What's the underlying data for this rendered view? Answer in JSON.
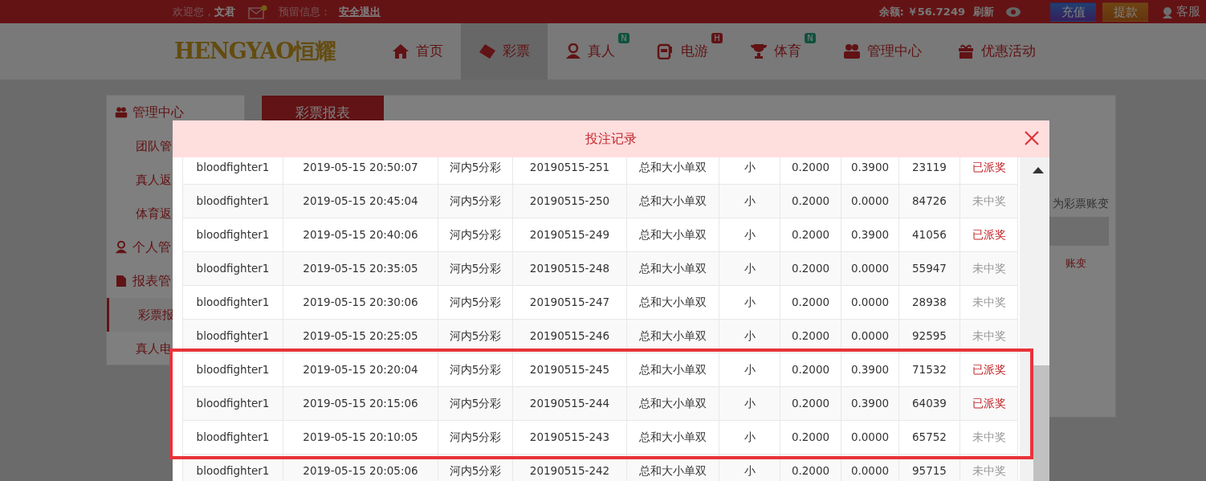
{
  "top_bar": {
    "welcome": "欢迎您，",
    "user": "文君",
    "mail_unread": true,
    "reserved_label": "预留信息：",
    "logout": "安全退出",
    "balance_label": "余额:",
    "balance": "￥56.7249",
    "refresh": "刷新",
    "deposit": "充值",
    "withdraw": "提款",
    "service": "客服"
  },
  "logo": "HENGYAO恒耀",
  "nav": [
    {
      "label": "首页",
      "selected": false
    },
    {
      "label": "彩票",
      "selected": true
    },
    {
      "label": "真人",
      "badge": "N",
      "selected": false
    },
    {
      "label": "电游",
      "badge": "H",
      "selected": false
    },
    {
      "label": "体育",
      "badge": "N",
      "selected": false
    },
    {
      "label": "管理中心",
      "selected": false
    },
    {
      "label": "优惠活动",
      "selected": false
    }
  ],
  "sidebar": {
    "items": [
      {
        "label": "管理中心",
        "kind": "group",
        "selected": false
      },
      {
        "label": "团队管",
        "kind": "item",
        "selected": false
      },
      {
        "label": "真人返",
        "kind": "item",
        "selected": false
      },
      {
        "label": "体育返",
        "kind": "item",
        "selected": false
      },
      {
        "label": "个人管",
        "kind": "group",
        "selected": false
      },
      {
        "label": "报表管",
        "kind": "group",
        "selected": false
      },
      {
        "label": "彩票报",
        "kind": "item",
        "selected": true
      },
      {
        "label": "真人电",
        "kind": "item",
        "selected": false
      }
    ]
  },
  "content": {
    "tab": "彩票报表",
    "note": "为彩票账变",
    "row_text": "账变"
  },
  "modal": {
    "title": "投注记录",
    "rows": [
      {
        "cells": [
          "bloodfighter1",
          "2019-05-15 20:50:07",
          "河内5分彩",
          "20190515-251",
          "总和大小单双",
          "小",
          "0.2000",
          "0.3900",
          "23119"
        ],
        "status": "已派奖",
        "won": true,
        "highlighted": false
      },
      {
        "cells": [
          "bloodfighter1",
          "2019-05-15 20:45:04",
          "河内5分彩",
          "20190515-250",
          "总和大小单双",
          "小",
          "0.2000",
          "0.0000",
          "84726"
        ],
        "status": "未中奖",
        "won": false,
        "highlighted": false
      },
      {
        "cells": [
          "bloodfighter1",
          "2019-05-15 20:40:06",
          "河内5分彩",
          "20190515-249",
          "总和大小单双",
          "小",
          "0.2000",
          "0.3900",
          "41056"
        ],
        "status": "已派奖",
        "won": true,
        "highlighted": false
      },
      {
        "cells": [
          "bloodfighter1",
          "2019-05-15 20:35:05",
          "河内5分彩",
          "20190515-248",
          "总和大小单双",
          "小",
          "0.2000",
          "0.0000",
          "55947"
        ],
        "status": "未中奖",
        "won": false,
        "highlighted": false
      },
      {
        "cells": [
          "bloodfighter1",
          "2019-05-15 20:30:06",
          "河内5分彩",
          "20190515-247",
          "总和大小单双",
          "小",
          "0.2000",
          "0.0000",
          "28938"
        ],
        "status": "未中奖",
        "won": false,
        "highlighted": false
      },
      {
        "cells": [
          "bloodfighter1",
          "2019-05-15 20:25:05",
          "河内5分彩",
          "20190515-246",
          "总和大小单双",
          "小",
          "0.2000",
          "0.0000",
          "92595"
        ],
        "status": "未中奖",
        "won": false,
        "highlighted": false
      },
      {
        "cells": [
          "bloodfighter1",
          "2019-05-15 20:20:04",
          "河内5分彩",
          "20190515-245",
          "总和大小单双",
          "小",
          "0.2000",
          "0.3900",
          "71532"
        ],
        "status": "已派奖",
        "won": true,
        "highlighted": true
      },
      {
        "cells": [
          "bloodfighter1",
          "2019-05-15 20:15:06",
          "河内5分彩",
          "20190515-244",
          "总和大小单双",
          "小",
          "0.2000",
          "0.3900",
          "64039"
        ],
        "status": "已派奖",
        "won": true,
        "highlighted": true
      },
      {
        "cells": [
          "bloodfighter1",
          "2019-05-15 20:10:05",
          "河内5分彩",
          "20190515-243",
          "总和大小单双",
          "小",
          "0.2000",
          "0.0000",
          "65752"
        ],
        "status": "未中奖",
        "won": false,
        "highlighted": true
      },
      {
        "cells": [
          "bloodfighter1",
          "2019-05-15 20:05:06",
          "河内5分彩",
          "20190515-242",
          "总和大小单双",
          "小",
          "0.2000",
          "0.0000",
          "95715"
        ],
        "status": "未中奖",
        "won": false,
        "highlighted": false
      }
    ]
  }
}
